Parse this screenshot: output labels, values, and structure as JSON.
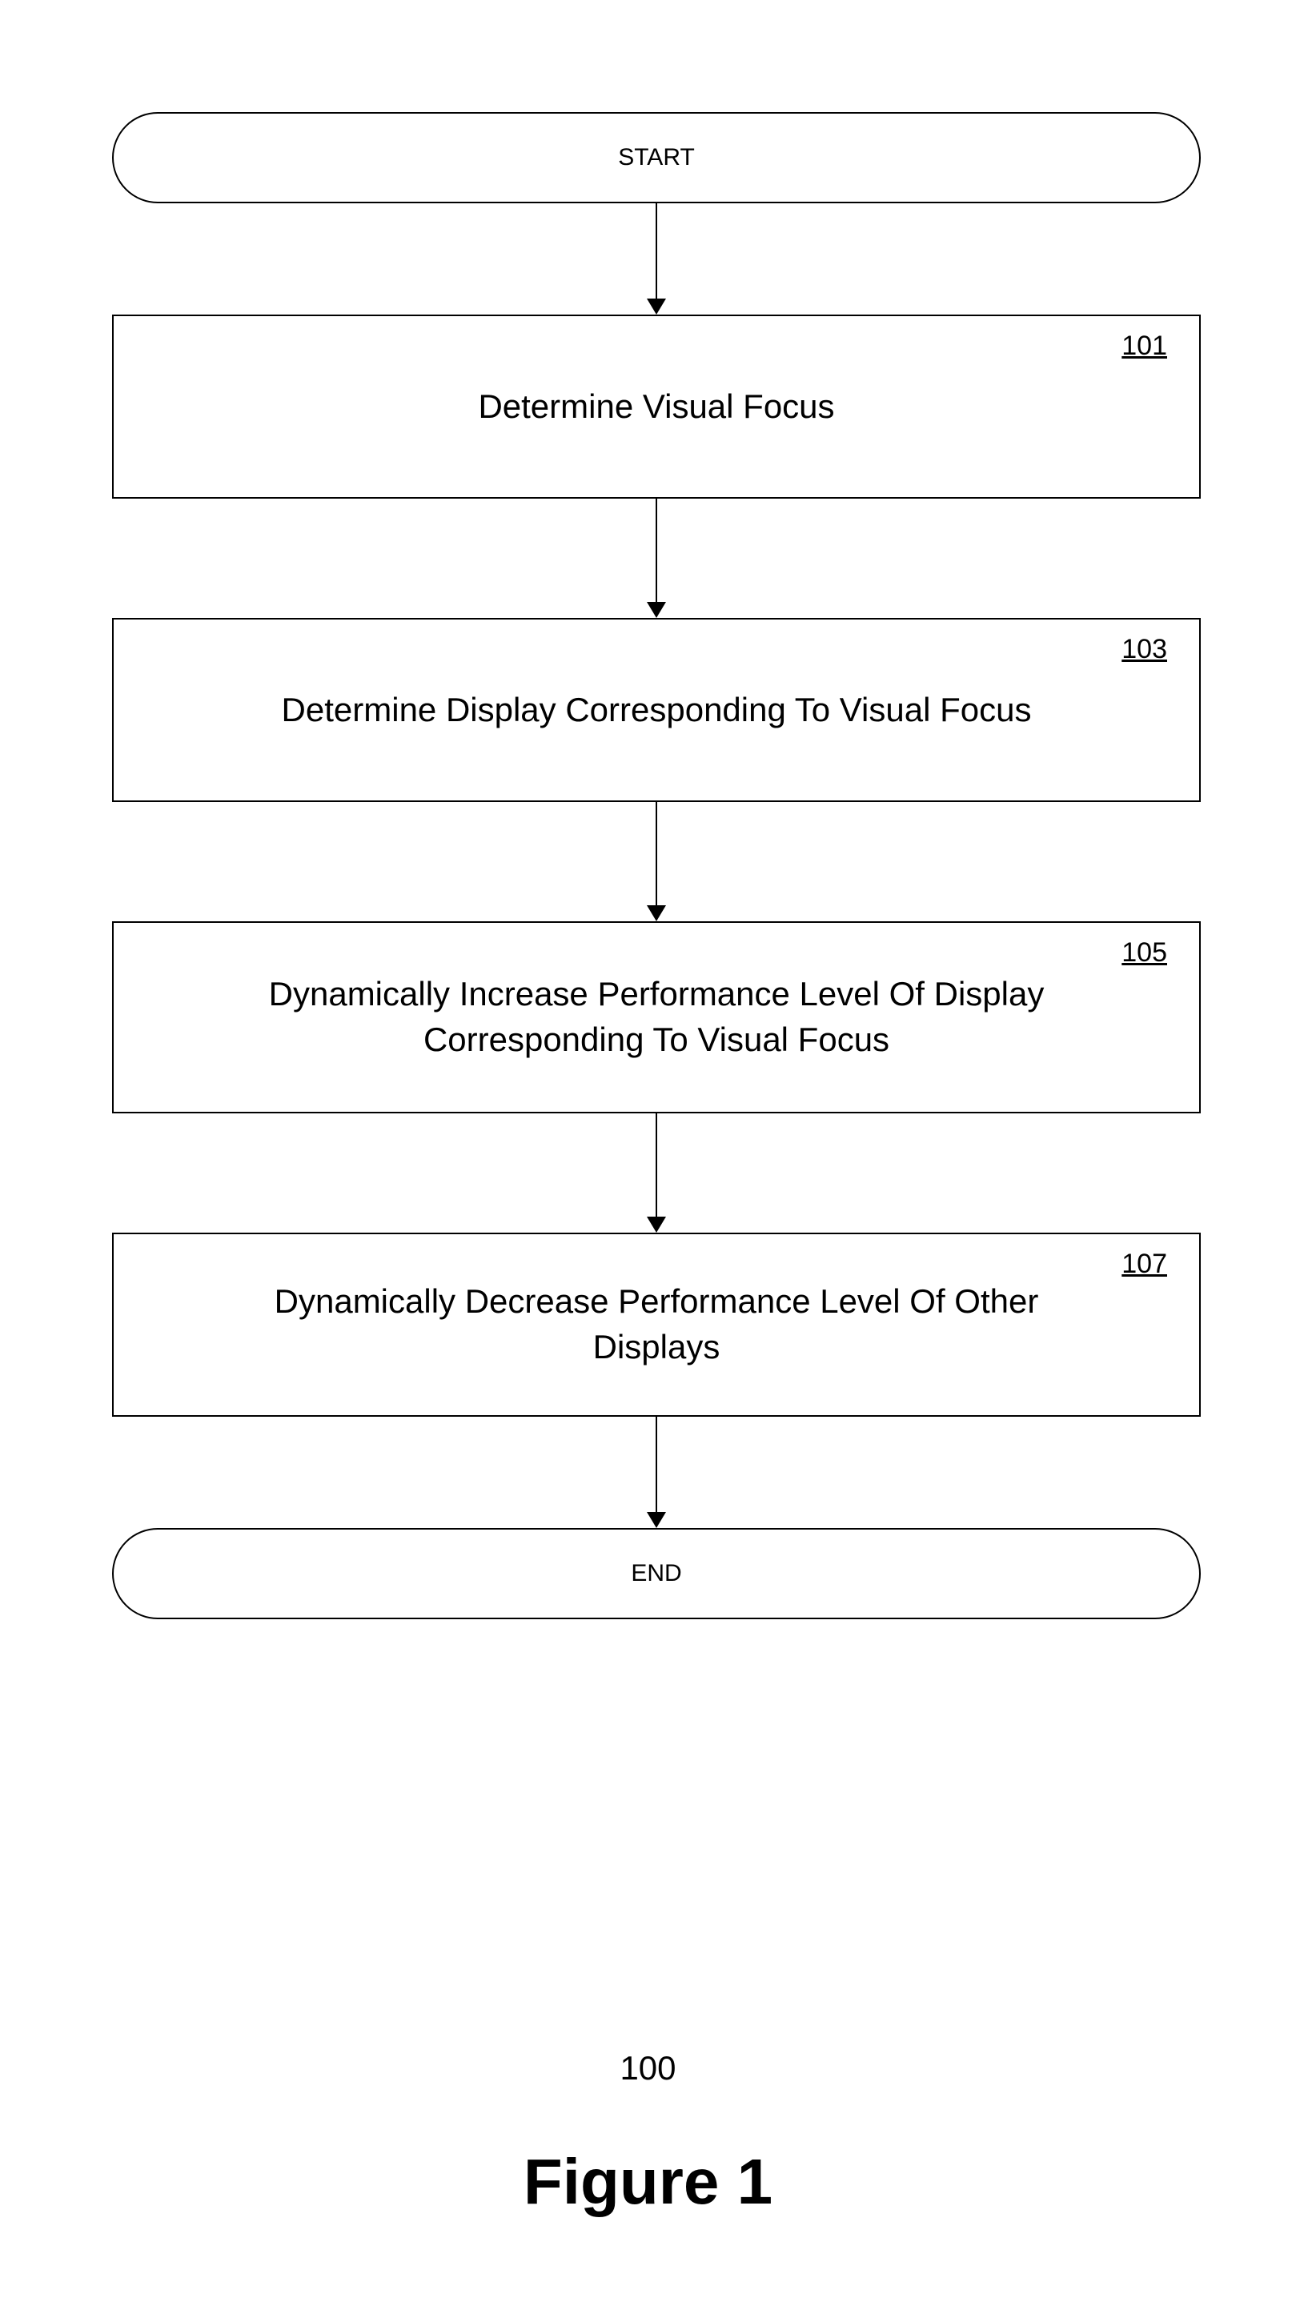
{
  "chart_data": {
    "type": "flowchart",
    "title": "Figure 1",
    "figure_number": "100",
    "nodes": [
      {
        "id": "start",
        "shape": "terminal",
        "label": "START"
      },
      {
        "id": "101",
        "shape": "process",
        "ref": "101",
        "label": "Determine Visual Focus"
      },
      {
        "id": "103",
        "shape": "process",
        "ref": "103",
        "label": "Determine Display Corresponding To Visual Focus"
      },
      {
        "id": "105",
        "shape": "process",
        "ref": "105",
        "label": "Dynamically Increase Performance Level Of Display Corresponding To Visual Focus"
      },
      {
        "id": "107",
        "shape": "process",
        "ref": "107",
        "label": "Dynamically Decrease Performance Level Of Other Displays"
      },
      {
        "id": "end",
        "shape": "terminal",
        "label": "END"
      }
    ],
    "edges": [
      {
        "from": "start",
        "to": "101"
      },
      {
        "from": "101",
        "to": "103"
      },
      {
        "from": "103",
        "to": "105"
      },
      {
        "from": "105",
        "to": "107"
      },
      {
        "from": "107",
        "to": "end"
      }
    ]
  },
  "terminals": {
    "start": "START",
    "end": "END"
  },
  "steps": {
    "s101": {
      "ref": "101",
      "label": "Determine Visual Focus"
    },
    "s103": {
      "ref": "103",
      "label": "Determine Display Corresponding To Visual Focus"
    },
    "s105": {
      "ref": "105",
      "label": "Dynamically Increase Performance Level Of Display Corresponding To Visual Focus"
    },
    "s107": {
      "ref": "107",
      "label": "Dynamically Decrease Performance Level Of Other Displays"
    }
  },
  "figure": {
    "number": "100",
    "title": "Figure 1"
  },
  "layout": {
    "arrow_short": 120,
    "arrow_long": 130,
    "h_small": 230,
    "h_large": 240
  }
}
